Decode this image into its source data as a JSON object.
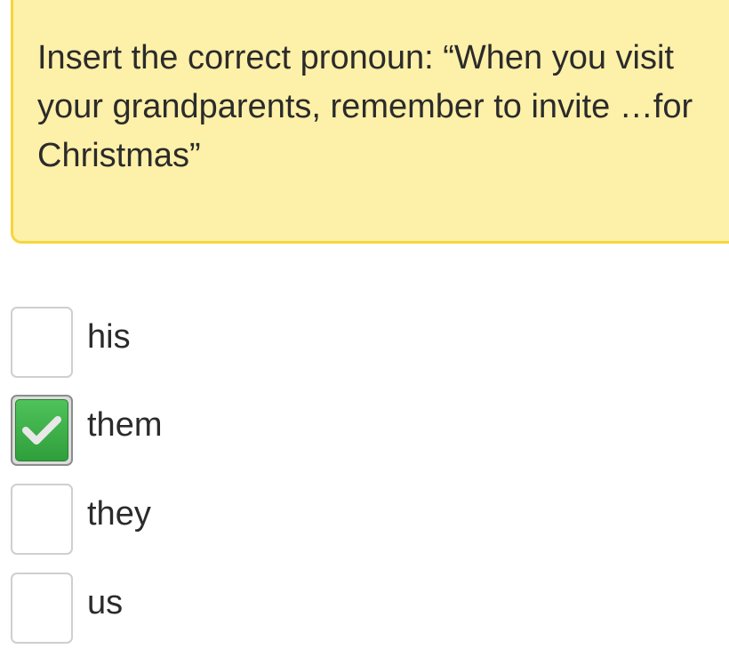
{
  "question": {
    "text": "Insert the correct pronoun: “When you visit\nyour grandparents, remember to invite …for\nChristmas”"
  },
  "options": [
    {
      "label": "his",
      "checked": false
    },
    {
      "label": "them",
      "checked": true
    },
    {
      "label": "they",
      "checked": false
    },
    {
      "label": "us",
      "checked": false
    }
  ],
  "colors": {
    "question_background": "#fdf0a8",
    "question_border": "#f5d63c",
    "checked_green": "#3bb048"
  },
  "icons": {
    "checked": "check-icon"
  }
}
